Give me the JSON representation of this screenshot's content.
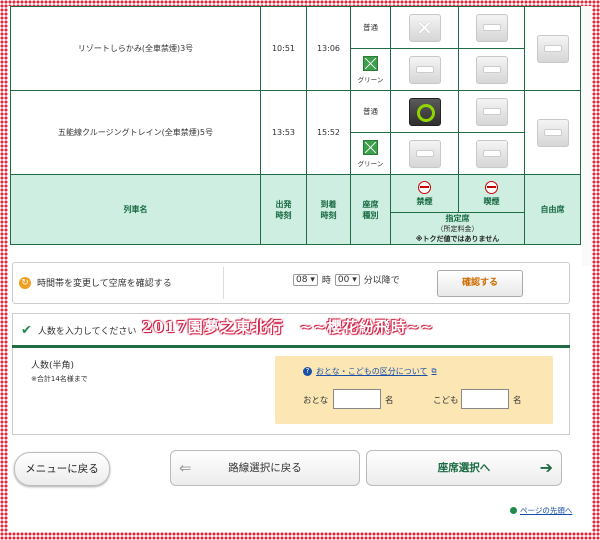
{
  "trains": [
    {
      "name": "リゾートしらかみ(全車禁煙)3号",
      "depart": "10:51",
      "arrive": "13:06",
      "rows": [
        {
          "seat_type": "普通",
          "icon": "none",
          "nonsmoking": "cross",
          "smoking": "dash"
        },
        {
          "seat_type": "グリーン",
          "icon": "green-car-icon",
          "nonsmoking": "dash",
          "smoking": "dash"
        }
      ],
      "free_seat": "dash"
    },
    {
      "name": "五能線クルージングトレイン(全車禁煙)5号",
      "depart": "13:53",
      "arrive": "15:52",
      "rows": [
        {
          "seat_type": "普通",
          "icon": "none",
          "nonsmoking": "available",
          "smoking": "dash"
        },
        {
          "seat_type": "グリーン",
          "icon": "green-car-icon",
          "nonsmoking": "dash",
          "smoking": "dash"
        }
      ],
      "free_seat": "dash"
    }
  ],
  "table_header": {
    "train_name": "列車名",
    "depart": "出発\n時刻",
    "arrive": "到着\n時刻",
    "seat_type": "座席\n種別",
    "nonsmoking": "禁煙",
    "smoking": "喫煙",
    "reserved": "指定席",
    "reserved_note1": "（所定料金）",
    "reserved_note2": "※トクだ値ではありません",
    "free_seat": "自由席"
  },
  "timebar": {
    "label": "時間帯を変更して空席を確認する",
    "hour": "08",
    "hour_unit": "時",
    "minute": "00",
    "minute_unit": "分以降で",
    "confirm": "確認する"
  },
  "people": {
    "heading": "人数を入力してください",
    "label": "人数(半角)",
    "note": "※合計14名様まで",
    "info_link": "おとな・こどもの区分について",
    "adult": "おとな",
    "child": "こども",
    "unit": "名"
  },
  "buttons": {
    "menu": "メニューに戻る",
    "back": "路線選択に戻る",
    "next": "座席選択へ"
  },
  "page_top": "ページの先頭へ",
  "watermark": "2017園夢之東北行　~~櫻花紛飛時~~",
  "colors": {
    "header_green": "#cdeee0",
    "border_green": "#1f6b44",
    "accent_orange": "#d06b00"
  }
}
